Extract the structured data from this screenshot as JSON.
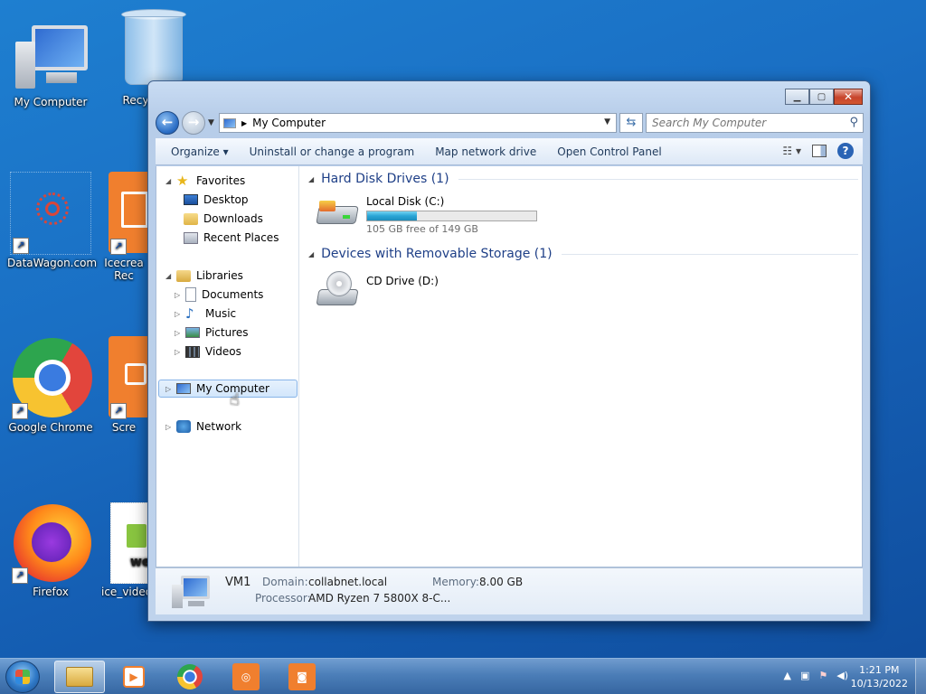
{
  "desktop": {
    "icons": [
      {
        "label": "My Computer"
      },
      {
        "label": "Recy"
      },
      {
        "label": "DataWagon.com"
      },
      {
        "label": "Icecrea",
        "label2": "Rec"
      },
      {
        "label": "Google Chrome"
      },
      {
        "label": "Scre"
      },
      {
        "label": "Firefox"
      },
      {
        "label": "ice_video"
      }
    ]
  },
  "window": {
    "address": "My Computer",
    "search_placeholder": "Search My Computer",
    "toolbar": {
      "organize": "Organize ▾",
      "uninstall": "Uninstall or change a program",
      "map_drive": "Map network drive",
      "control_panel": "Open Control Panel"
    },
    "nav": {
      "favorites": "Favorites",
      "desktop": "Desktop",
      "downloads": "Downloads",
      "recent": "Recent Places",
      "libraries": "Libraries",
      "documents": "Documents",
      "music": "Music",
      "pictures": "Pictures",
      "videos": "Videos",
      "computer": "My Computer",
      "network": "Network"
    },
    "groups": {
      "hdd_header": "Hard Disk Drives (1)",
      "removable_header": "Devices with Removable Storage (1)"
    },
    "drives": {
      "c_name": "Local Disk (C:)",
      "c_free": "105 GB free of 149 GB",
      "c_used_fraction": 0.295,
      "d_name": "CD Drive (D:)"
    },
    "details": {
      "computer_name": "VM1",
      "domain_label": "Domain:",
      "domain": "collabnet.local",
      "memory_label": "Memory:",
      "memory": "8.00 GB",
      "processor_label": "Processor:",
      "processor": "AMD Ryzen 7 5800X 8-C..."
    }
  },
  "taskbar": {
    "time": "1:21 PM",
    "date": "10/13/2022"
  },
  "colors": {
    "desktop": "#1a6fc4",
    "accent": "#1e3f87"
  }
}
